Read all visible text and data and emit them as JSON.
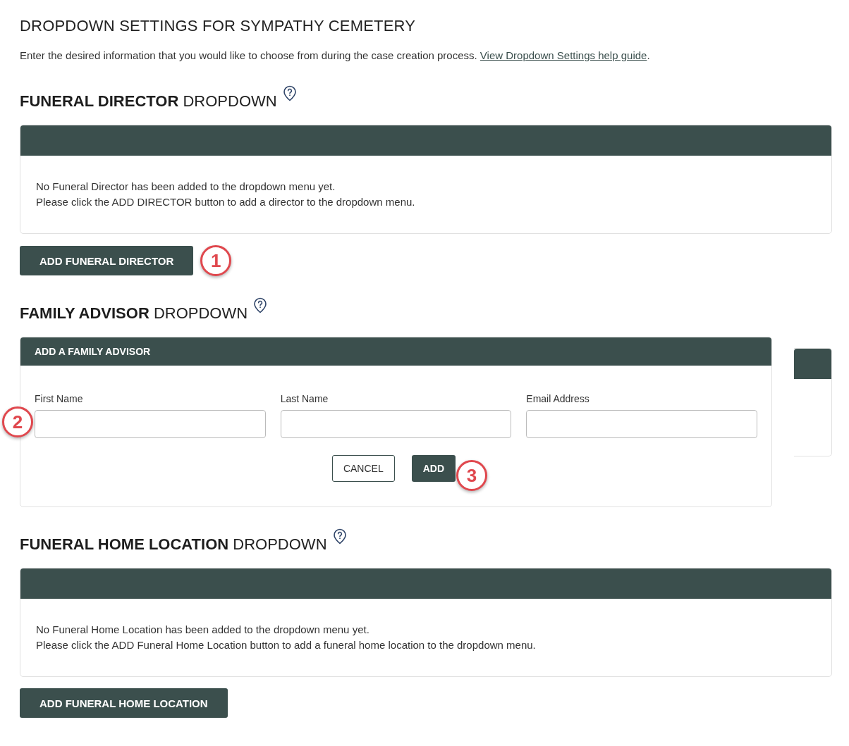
{
  "page_title": "DROPDOWN SETTINGS FOR SYMPATHY CEMETERY",
  "intro": {
    "text": "Enter the desired information that you would like to choose from during the case creation process.",
    "link": "View Dropdown Settings help guide",
    "suffix": "."
  },
  "sections": [
    {
      "kind": "list",
      "title_bold": "FUNERAL DIRECTOR",
      "title_rest": "DROPDOWN",
      "empty_lines": [
        "No Funeral Director has been added to the dropdown menu yet.",
        "Please click the ADD DIRECTOR button to add a director to the dropdown menu."
      ],
      "button": "ADD FUNERAL DIRECTOR",
      "callout": "1"
    },
    {
      "kind": "form",
      "title_bold": "FAMILY ADVISOR",
      "title_rest": "DROPDOWN",
      "form_title": "ADD A FAMILY ADVISOR",
      "fields": [
        {
          "label": "First Name",
          "callout": "2"
        },
        {
          "label": "Last Name"
        },
        {
          "label": "Email Address"
        }
      ],
      "actions": [
        {
          "label": "CANCEL",
          "kind": "secondary"
        },
        {
          "label": "ADD",
          "kind": "primary",
          "callout": "3"
        }
      ]
    },
    {
      "kind": "list",
      "title_bold": "FUNERAL HOME LOCATION",
      "title_rest": "DROPDOWN",
      "empty_lines": [
        "No Funeral Home Location has been added to the dropdown menu yet.",
        "Please click the ADD Funeral Home Location button to add a funeral home location to the dropdown menu."
      ],
      "button": "ADD FUNERAL HOME LOCATION"
    }
  ]
}
